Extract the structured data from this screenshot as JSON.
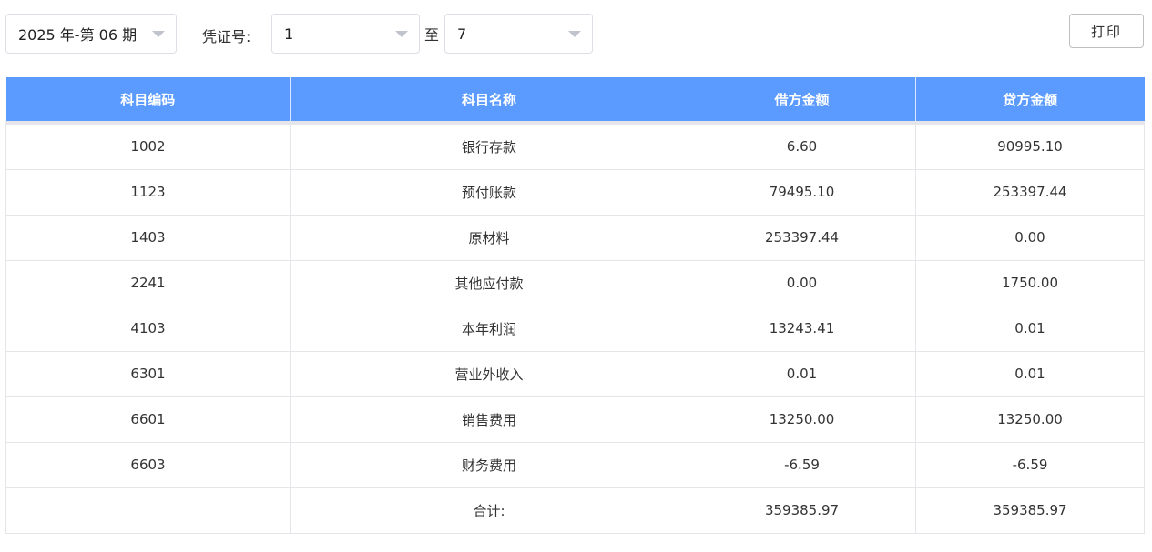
{
  "filters": {
    "period": "2025 年-第 06 期",
    "voucher_label": "凭证号:",
    "voucher_from": "1",
    "to_label": "至",
    "voucher_to": "7"
  },
  "toolbar": {
    "print_label": "打印"
  },
  "table": {
    "headers": [
      "科目编码",
      "科目名称",
      "借方金额",
      "贷方金额"
    ],
    "rows": [
      {
        "code": "1002",
        "name": "银行存款",
        "debit": "6.60",
        "credit": "90995.10"
      },
      {
        "code": "1123",
        "name": "预付账款",
        "debit": "79495.10",
        "credit": "253397.44"
      },
      {
        "code": "1403",
        "name": "原材料",
        "debit": "253397.44",
        "credit": "0.00"
      },
      {
        "code": "2241",
        "name": "其他应付款",
        "debit": "0.00",
        "credit": "1750.00"
      },
      {
        "code": "4103",
        "name": "本年利润",
        "debit": "13243.41",
        "credit": "0.01"
      },
      {
        "code": "6301",
        "name": "营业外收入",
        "debit": "0.01",
        "credit": "0.01"
      },
      {
        "code": "6601",
        "name": "销售费用",
        "debit": "13250.00",
        "credit": "13250.00"
      },
      {
        "code": "6603",
        "name": "财务费用",
        "debit": "-6.59",
        "credit": "-6.59"
      }
    ],
    "total": {
      "code": "",
      "name": "合计:",
      "debit": "359385.97",
      "credit": "359385.97"
    }
  },
  "colors": {
    "header_bg": "#5b9bff",
    "border": "#e4e6ea"
  }
}
